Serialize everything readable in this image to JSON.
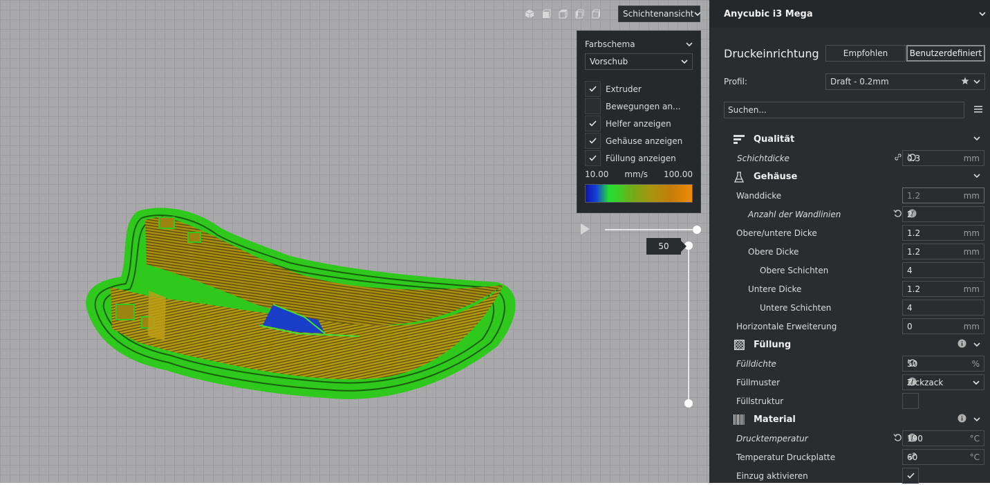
{
  "viewport": {
    "view_mode": "Schichtenansicht",
    "view_icons": [
      "cube-3d-icon",
      "cube-front-icon",
      "cube-top-icon",
      "cube-left-icon",
      "cube-right-icon"
    ],
    "layer_number": "50"
  },
  "color_panel": {
    "title": "Farbschema",
    "scheme": "Vorschub",
    "options": [
      {
        "label": "Extruder",
        "checked": true
      },
      {
        "label": "Bewegungen an...",
        "checked": false
      },
      {
        "label": "Helfer anzeigen",
        "checked": true
      },
      {
        "label": "Gehäuse anzeigen",
        "checked": true
      },
      {
        "label": "Füllung anzeigen",
        "checked": true
      }
    ],
    "scale_min": "10.00",
    "scale_unit": "mm/s",
    "scale_max": "100.00"
  },
  "printer": {
    "name": "Anycubic i3 Mega"
  },
  "setup": {
    "title": "Druckeinrichtung",
    "recommended": "Empfohlen",
    "custom": "Benutzerdefiniert"
  },
  "profile": {
    "label": "Profil:",
    "value": "Draft - 0.2mm"
  },
  "search": {
    "placeholder": "Suchen..."
  },
  "categories": {
    "quality": "Qualität",
    "shell": "Gehäuse",
    "infill": "Füllung",
    "material": "Material"
  },
  "settings": {
    "layer_height": {
      "label": "Schichtdicke",
      "value": "0.3",
      "unit": "mm"
    },
    "wall_thickness": {
      "label": "Wanddicke",
      "value": "1.2",
      "unit": "mm"
    },
    "wall_line_count": {
      "label": "Anzahl der Wandlinien",
      "value": "2"
    },
    "top_bottom_thickness": {
      "label": "Obere/untere Dicke",
      "value": "1.2",
      "unit": "mm"
    },
    "top_thickness": {
      "label": "Obere Dicke",
      "value": "1.2",
      "unit": "mm"
    },
    "top_layers": {
      "label": "Obere Schichten",
      "value": "4"
    },
    "bottom_thickness": {
      "label": "Untere Dicke",
      "value": "1.2",
      "unit": "mm"
    },
    "bottom_layers": {
      "label": "Untere Schichten",
      "value": "4"
    },
    "horizontal_expansion": {
      "label": "Horizontale Erweiterung",
      "value": "0",
      "unit": "mm"
    },
    "infill_density": {
      "label": "Fülldichte",
      "value": "50",
      "unit": "%"
    },
    "infill_pattern": {
      "label": "Füllmuster",
      "value": "Zickzack"
    },
    "infill_structure": {
      "label": "Füllstruktur"
    },
    "print_temperature": {
      "label": "Drucktemperatur",
      "value": "190",
      "unit": "°C"
    },
    "bed_temperature": {
      "label": "Temperatur Druckplatte",
      "value": "60",
      "unit": "°C"
    },
    "retraction": {
      "label": "Einzug aktivieren",
      "checked": true
    }
  }
}
